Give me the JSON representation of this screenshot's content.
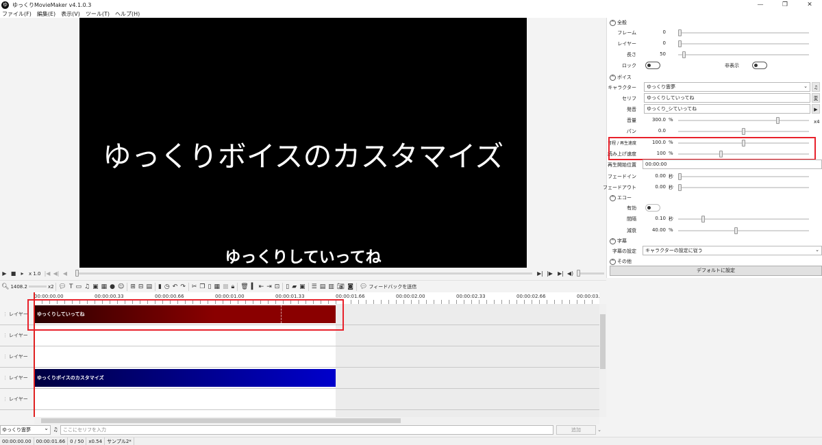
{
  "window": {
    "title": "ゆっくりMovieMaker v4.1.0.3",
    "app_icon": "ゆ",
    "controls": [
      "—",
      "❐",
      "✕"
    ]
  },
  "menu": [
    "ファイル(F)",
    "編集(E)",
    "表示(V)",
    "ツール(T)",
    "ヘルプ(H)"
  ],
  "preview": {
    "main_text": "ゆっくりボイスのカスタマイズ",
    "subtitle": "ゆっくりしていってね"
  },
  "transport": {
    "speed": "x 1.0"
  },
  "toolbar": {
    "zoom_value": "1408.2",
    "zoom_mult": "x2",
    "feedback_label": "フィードバックを送信"
  },
  "ruler": {
    "labels": [
      "00:00:00.00",
      "00:00:00.33",
      "00:00:00.66",
      "00:00:01.00",
      "00:00:01.33",
      "00:00:01.66",
      "00:00:02.00",
      "00:00:02.33",
      "00:00:02.66",
      "00:00:03.0"
    ]
  },
  "layers": [
    {
      "label": "レイヤー 00",
      "clip": "ゆっくりしていってね",
      "clip_type": "voice"
    },
    {
      "label": "レイヤー 01",
      "clip": "",
      "clip_type": ""
    },
    {
      "label": "レイヤー 02",
      "clip": "",
      "clip_type": ""
    },
    {
      "label": "レイヤー 03",
      "clip": "ゆっくりボイスのカスタマイズ",
      "clip_type": "text"
    },
    {
      "label": "レイヤー 04",
      "clip": "",
      "clip_type": ""
    }
  ],
  "input_bar": {
    "character": "ゆっくり霊夢",
    "placeholder": "ここにセリフを入力",
    "add_button": "追加"
  },
  "status_bar": [
    "00:00:00.00",
    "00:00:01.66",
    "0 / 50",
    "x0.54",
    "サンプル2*"
  ],
  "props": {
    "general": {
      "header": "全般",
      "frame_label": "フレーム",
      "frame_value": "0",
      "layer_label": "レイヤー",
      "layer_value": "0",
      "length_label": "長さ",
      "length_value": "50",
      "lock_label": "ロック",
      "hidden_label": "非表示"
    },
    "voice": {
      "header": "ボイス",
      "character_label": "キャラクター",
      "character_value": "ゆっくり霊夢",
      "serif_label": "セリフ",
      "serif_value": "ゆっくりしていってね",
      "pronounce_label": "発音",
      "pronounce_value": "ゆっくり_シていってね",
      "convert_button": "変",
      "play_button": "▶",
      "volume_label": "音量",
      "volume_value": "300.0",
      "volume_unit": "%",
      "volume_x4": "x4",
      "pan_label": "パン",
      "pan_value": "0.0",
      "pitch_label": "音程 / 再生速度",
      "pitch_value": "100.0",
      "pitch_unit": "%",
      "read_speed_label": "読み上げ速度",
      "read_speed_value": "100",
      "read_speed_unit": "%",
      "start_pos_label": "再生開始位置",
      "start_pos_value": "00:00:00",
      "fadein_label": "フェードイン",
      "fadein_value": "0.00",
      "fadein_unit": "秒",
      "fadeout_label": "フェードアウト",
      "fadeout_value": "0.00",
      "fadeout_unit": "秒"
    },
    "echo": {
      "header": "エコー",
      "enabled_label": "有効",
      "interval_label": "間隔",
      "interval_value": "0.10",
      "interval_unit": "秒",
      "decay_label": "減衰",
      "decay_value": "40.00",
      "decay_unit": "%"
    },
    "subtitle": {
      "header": "字幕",
      "setting_label": "字幕の設定",
      "setting_value": "キャラクターの設定に従う"
    },
    "other": {
      "header": "その他"
    },
    "default_button": "デフォルトに設定"
  }
}
